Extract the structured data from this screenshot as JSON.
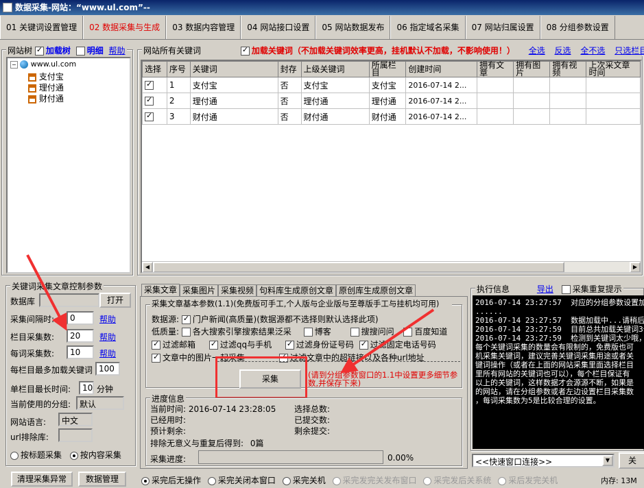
{
  "title": "数据采集-网站：“www.ul.com”--",
  "tabs": [
    "01 关键词设置管理",
    "02 数据采集与生成",
    "03 数据内容管理",
    "04 网站接口设置",
    "05 网站数据发布",
    "06 指定域名采集",
    "07 网站归属设置",
    "08 分组参数设置"
  ],
  "tree_panel": {
    "title": "网站树",
    "load_tree": "加载树",
    "detail": "明细",
    "help": "帮助",
    "nodes": [
      "www.ul.com",
      "支付宝",
      "理付通",
      "财付通"
    ]
  },
  "keywords_panel": {
    "title": "网站所有关键词",
    "load_kw": "加载关键词（不加载关键词效率更高，挂机默认不加载，不影响使用！）",
    "select_all": "全选",
    "invert": "反选",
    "select_none": "全不选",
    "select_column": "只选栏目",
    "columns": [
      "选择",
      "序号",
      "关键词",
      "封存",
      "上级关键词",
      "所属栏目",
      "创建时间",
      "拥有文章",
      "拥有图片",
      "拥有视频",
      "上次采文章时间"
    ],
    "rows": [
      [
        "1",
        "支付宝",
        "否",
        "支付宝",
        "支付宝",
        "2016-07-14 2..."
      ],
      [
        "2",
        "理付通",
        "否",
        "理付通",
        "理付通",
        "2016-07-14 2..."
      ],
      [
        "3",
        "财付通",
        "否",
        "财付通",
        "财付通",
        "2016-07-14 2..."
      ]
    ]
  },
  "control_panel": {
    "title": "关键词采集文章控制参数",
    "db_label": "数据库",
    "open": "打开",
    "interval_label": "采集间隔时:",
    "interval_value": "0",
    "col_count_label": "栏目采集数:",
    "col_count_value": "20",
    "kw_count_label": "每词采集数:",
    "kw_count_value": "10",
    "max_kw_label": "每栏目最多加载关键词",
    "max_kw_value": "100",
    "max_time_label": "单栏目最长时间:",
    "max_time_value": "10",
    "minutes": "分钟",
    "help": "帮助",
    "group_label": "当前使用的分组:",
    "group_value": "默认",
    "lang_label": "网站语言:",
    "lang_value": "中文",
    "url_exclude_label": "url排除库:",
    "by_title": "按标题采集",
    "by_content": "按内容采集",
    "clear_btn": "清理采集异常",
    "data_btn": "数据管理"
  },
  "collect_tabs": [
    "采集文章",
    "采集图片",
    "采集视频",
    "句料库生成原创文章",
    "原创库生成原创文章"
  ],
  "collect_basic": {
    "title": "采集文章基本参数(1.1)(免费版可手工,个人版与企业版与至尊版手工与挂机均可用)",
    "source_label": "数据源:",
    "source_option": "门户新闻(高质量)(数据源都不选择则默认选择此项)",
    "low_label": "低质量:",
    "low_options": [
      "各大搜索引擎搜索结果泛采",
      "博客",
      "搜搜问问",
      "百度知道"
    ],
    "filters": [
      "过滤邮箱",
      "过滤qq与手机",
      "过滤身份证号码",
      "过滤固定电话号码"
    ],
    "pic_option": "文章中的图片一起采集",
    "link_option": "过滤文章中的超链接以及各种url地址",
    "collect_btn": "采集",
    "hint": "(请到分组参数窗口的1.1中设置更多细节参数,并保存下来)"
  },
  "progress": {
    "title": "进度信息",
    "now_label": "当前时间:",
    "now_value": "2016-07-14 23:28:05",
    "used_label": "已经用时:",
    "remain_label": "预计剩余:",
    "total_label": "选择总数:",
    "submitted_label": "已提交数:",
    "left_label": "剩余提交:",
    "excluded_label": "排除无意义与重复后得到:",
    "excluded_value": "0篇",
    "bar_label": "采集进度:",
    "percent_text": "0.00%",
    "percent": 0
  },
  "exec_info": {
    "title": "执行信息",
    "export": "导出",
    "repeat_hint": "采集重复提示",
    "lines": [
      "2016-07-14 23:27:57  对应的分组参数设置加",
      "......",
      "2016-07-14 23:27:57  数据加载中...请稍后",
      "",
      "2016-07-14 23:27:59  目前总共加载关键词3个",
      "",
      "",
      "2016-07-14 23:27:59  检测到关键词太少哦，",
      "每个关键词采集的数量会有限制的，免费版也可",
      "机采集关键词，建议完善关键词采集用途或者关",
      "键词操作（或者在上面的网站采集里面选择栏目",
      "里所有网站的关键词也可以），每个栏目保证有",
      "以上的关键词，这样数据才会源源不断，如果是",
      "的网站，请在分组参数或者左边设置栏目采集数",
      "，每词采集数为5是比较合理的设置。"
    ],
    "quick_link": "<<快速窗口连接>>",
    "close": "关"
  },
  "bottom_options": [
    "采完后无操作",
    "采完关闭本窗口",
    "采完关机",
    "采完发完关发布窗口",
    "采完发后关系统",
    "采后发完关机"
  ],
  "memory": "内存: 13M",
  "colors": {
    "accent_red": "#e00000",
    "link_blue": "#0000ee",
    "annotation": "#f03030"
  }
}
